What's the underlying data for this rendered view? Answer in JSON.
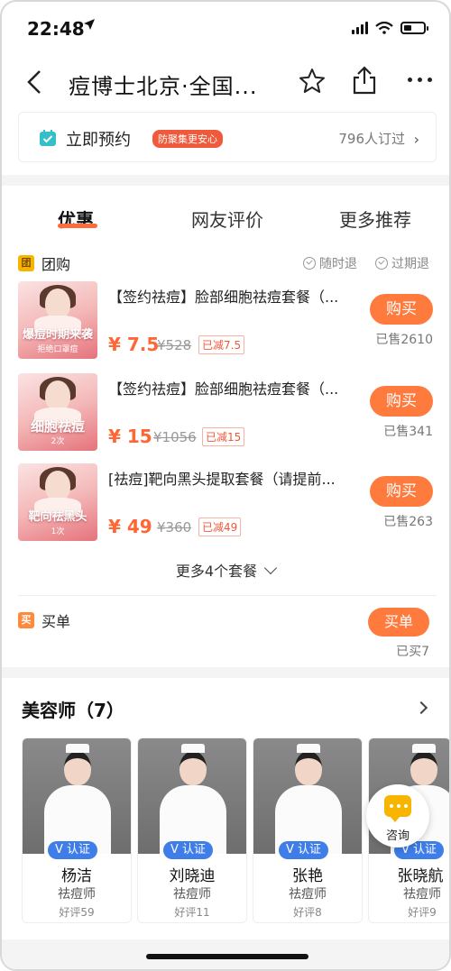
{
  "status_bar": {
    "time": "22:48"
  },
  "nav": {
    "title": "痘博士北京·全国..."
  },
  "booking": {
    "label": "立即预约",
    "tag": "防聚集更安心",
    "count": "796人订过"
  },
  "tabs": [
    "优惠",
    "网友评价",
    "更多推荐"
  ],
  "group_buy": {
    "badge": "团",
    "title": "团购",
    "policies": [
      "随时退",
      "过期退"
    ],
    "deals": [
      {
        "name": "【签约祛痘】脸部细胞祛痘套餐（...",
        "price": "¥ 7.5",
        "original": "¥528",
        "discount": "已减7.5",
        "button": "购买",
        "sold": "已售2610",
        "thumb_text": "爆痘时期来袭",
        "thumb_sub": "拒绝口罩痘"
      },
      {
        "name": "【签约祛痘】脸部细胞祛痘套餐（...",
        "price": "¥ 15",
        "original": "¥1056",
        "discount": "已减15",
        "button": "购买",
        "sold": "已售341",
        "thumb_text": "细胞祛痘",
        "thumb_sub": "2次"
      },
      {
        "name": "[祛痘]靶向黑头提取套餐（请提前...",
        "price": "¥ 49",
        "original": "¥360",
        "discount": "已减49",
        "button": "购买",
        "sold": "已售263",
        "thumb_text": "靶向祛黑头",
        "thumb_sub": "1次"
      }
    ],
    "more": "更多4个套餐"
  },
  "pay": {
    "badge": "买",
    "title": "买单",
    "button": "买单",
    "count": "已买7"
  },
  "staff": {
    "title": "美容师（7）",
    "verified": "认证",
    "members": [
      {
        "name": "杨洁",
        "role": "祛痘师",
        "rating": "好评59"
      },
      {
        "name": "刘晓迪",
        "role": "祛痘师",
        "rating": "好评11"
      },
      {
        "name": "张艳",
        "role": "祛痘师",
        "rating": "好评8"
      },
      {
        "name": "张晓航",
        "role": "祛痘师",
        "rating": "好评9"
      }
    ]
  },
  "consult": {
    "label": "咨询"
  },
  "colors": {
    "accent": "#ff7a3d",
    "price": "#ff6633",
    "verify": "#3f7de8",
    "tag": "#f05a3c"
  }
}
